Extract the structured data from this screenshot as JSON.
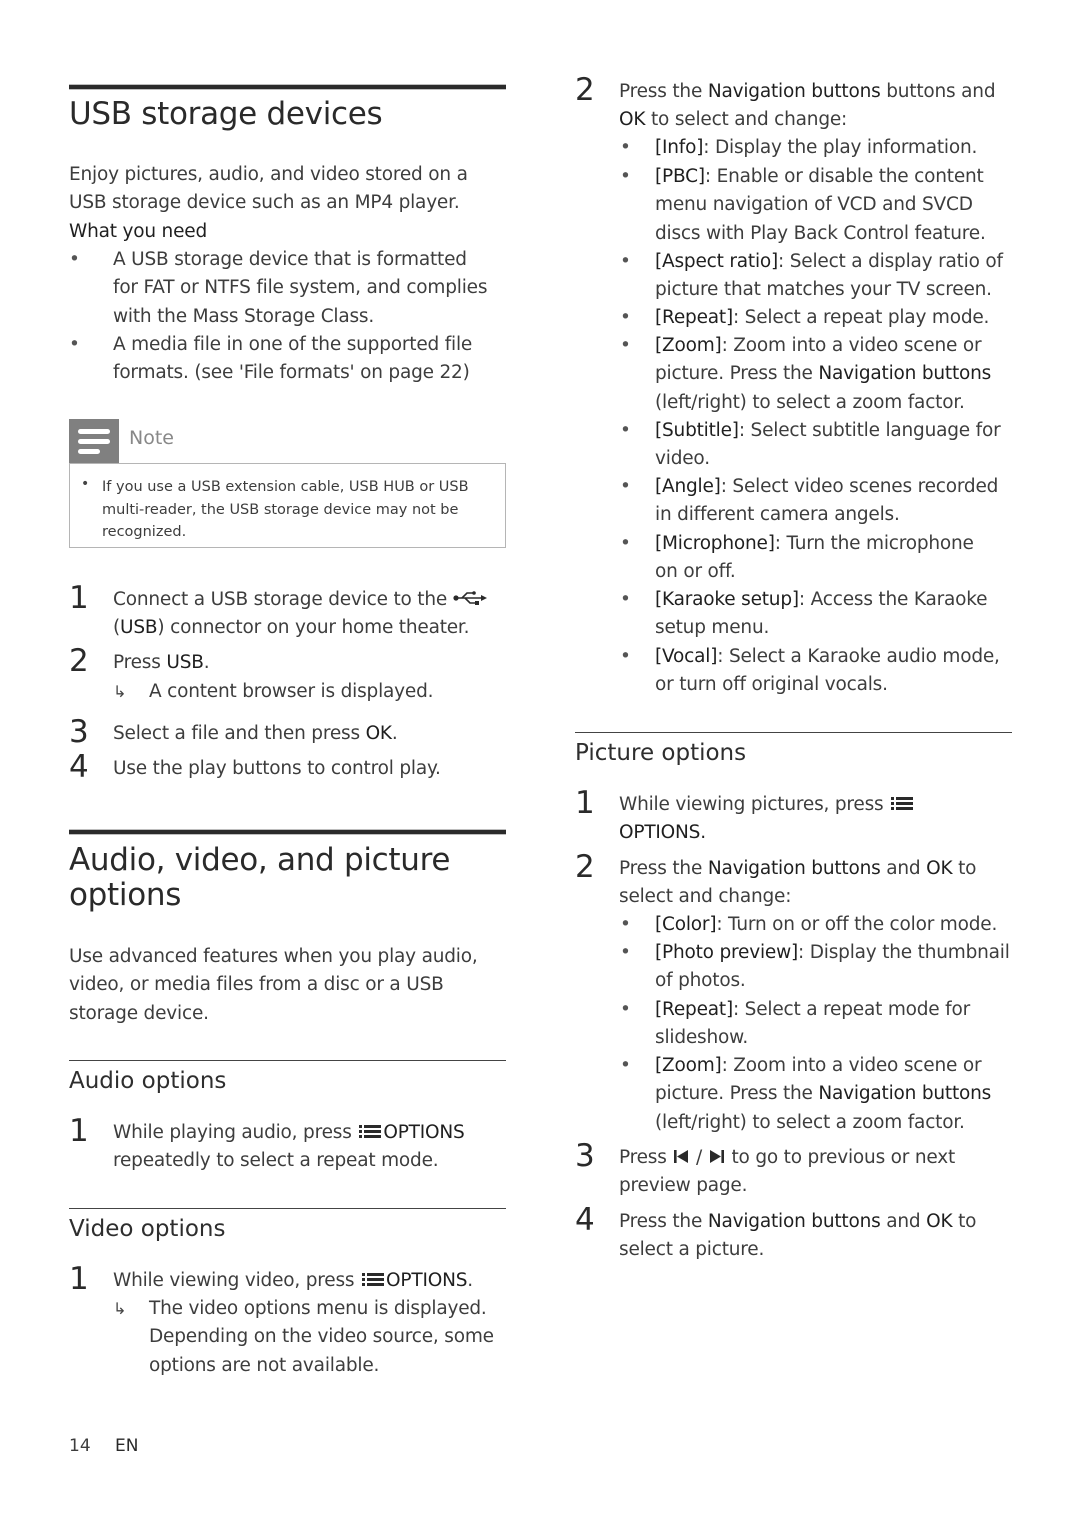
{
  "usb_section": {
    "title": "USB storage devices",
    "intro_line1": "Enjoy pictures, audio, and video stored on a",
    "intro_line2": "USB storage device such as an MP4 player.",
    "what_you_need_label": "What you need",
    "requirements": [
      {
        "lines": [
          "A USB storage device that is formatted",
          "for FAT or NTFS file system, and complies",
          "with the Mass Storage Class."
        ]
      },
      {
        "lines": [
          "A media file in one of the supported file",
          "formats. (see 'File formats' on page 22)"
        ]
      }
    ],
    "note": {
      "label": "Note",
      "icon": "note-icon",
      "lines": [
        "If you use a USB extension cable, USB HUB or USB",
        "multi-reader, the USB storage device may not be",
        "recognized."
      ]
    },
    "steps": [
      {
        "num": "1",
        "line1_pre": "Connect a USB storage device to the",
        "icon": "usb-icon",
        "line2_paren_open": "(",
        "line2_key": "USB",
        "line2_rest": ") connector on your home theater."
      },
      {
        "num": "2",
        "pre": "Press ",
        "key": "USB",
        "post": ".",
        "result": "A content browser is displayed."
      },
      {
        "num": "3",
        "pre": "Select a file and then press ",
        "key": "OK",
        "post": "."
      },
      {
        "num": "4",
        "text": "Use the play buttons to control play."
      }
    ]
  },
  "options_section": {
    "title_line1": "Audio, video, and picture",
    "title_line2": "options",
    "intro_lines": [
      "Use advanced features when you play audio,",
      "video, or media files from a disc or a USB",
      "storage device."
    ],
    "audio": {
      "title": "Audio options",
      "step1_num": "1",
      "step1_pre": "While playing audio, press",
      "step1_icon": "options-icon",
      "step1_key": "OPTIONS",
      "step1_line2": "repeatedly to select a repeat mode."
    },
    "video": {
      "title": "Video options",
      "step1_num": "1",
      "step1_pre": "While viewing video, press",
      "step1_icon": "options-icon",
      "step1_key": "OPTIONS",
      "step1_post": ".",
      "result_lines": [
        "The video options menu is displayed.",
        "Depending on the video source, some",
        "options are not available."
      ],
      "step2_num": "2",
      "step2_pre": "Press the ",
      "step2_key": "Navigation buttons",
      "step2_post": " buttons and",
      "step2_line2_key": "OK",
      "step2_line2_rest": " to select and change:",
      "items": [
        {
          "key": "[Info]",
          "lines": [
            ": Display the play information."
          ]
        },
        {
          "key": "[PBC]",
          "lines": [
            ": Enable or disable the content",
            "menu navigation of VCD and SVCD",
            "discs with Play Back Control feature."
          ]
        },
        {
          "key": "[Aspect ratio]",
          "lines": [
            ": Select a display ratio of",
            "picture that matches your TV screen."
          ]
        },
        {
          "key": "[Repeat]",
          "lines": [
            ": Select a repeat play mode."
          ]
        },
        {
          "key": "[Zoom]",
          "lines": [
            ": Zoom into a video scene or",
            "picture. Press the ",
            "(left/right) to select a zoom factor."
          ],
          "inline_key": "Navigation buttons"
        },
        {
          "key": "[Subtitle]",
          "lines": [
            ": Select subtitle language for",
            "video."
          ]
        },
        {
          "key": "[Angle]",
          "lines": [
            ": Select video scenes recorded",
            "in different camera angels."
          ]
        },
        {
          "key": "[Microphone]",
          "lines": [
            ": Turn the microphone",
            "on or off."
          ]
        },
        {
          "key": "[Karaoke setup]",
          "lines": [
            ": Access the Karaoke",
            "setup menu."
          ]
        },
        {
          "key": "[Vocal]",
          "lines": [
            ": Select a Karaoke audio mode,",
            "or turn off original vocals."
          ]
        }
      ]
    },
    "picture": {
      "title": "Picture options",
      "step1_num": "1",
      "step1_pre": "While viewing pictures, press",
      "step1_icon": "options-icon",
      "step1_key": "OPTIONS.",
      "step2_num": "2",
      "step2_pre": "Press the ",
      "step2_key": "Navigation buttons",
      "step2_mid": " and ",
      "step2_key2": "OK",
      "step2_post": " to",
      "step2_line2": "select and change:",
      "items": [
        {
          "key": "[Color]",
          "lines": [
            ": Turn on or off the color mode."
          ]
        },
        {
          "key": "[Photo preview]",
          "lines": [
            ": Display the thumbnail",
            "of photos."
          ]
        },
        {
          "key": "[Repeat]",
          "lines": [
            ": Select a repeat mode for",
            "slideshow."
          ]
        },
        {
          "key": "[Zoom]",
          "lines": [
            ": Zoom into a video scene or",
            "picture. Press the ",
            "(left/right) to select a zoom factor."
          ],
          "inline_key": "Navigation buttons"
        }
      ],
      "step3_num": "3",
      "step3_pre": "Press ",
      "step3_icon_prev": "previous-icon",
      "step3_sep": " / ",
      "step3_icon_next": "next-icon",
      "step3_post": " to go to previous or next",
      "step3_line2": "preview page.",
      "step4_num": "4",
      "step4_pre": "Press the ",
      "step4_key": "Navigation buttons",
      "step4_mid": " and ",
      "step4_key2": "OK",
      "step4_post": " to",
      "step4_line2": "select a picture."
    }
  },
  "footer": {
    "page_number": "14",
    "language": "EN"
  },
  "colors": {
    "text": "#3d3d3d",
    "heading": "#2a2a2a",
    "note_header_bg": "#808080",
    "note_border": "#b5b5b5",
    "rule": "#2b2b2b"
  }
}
